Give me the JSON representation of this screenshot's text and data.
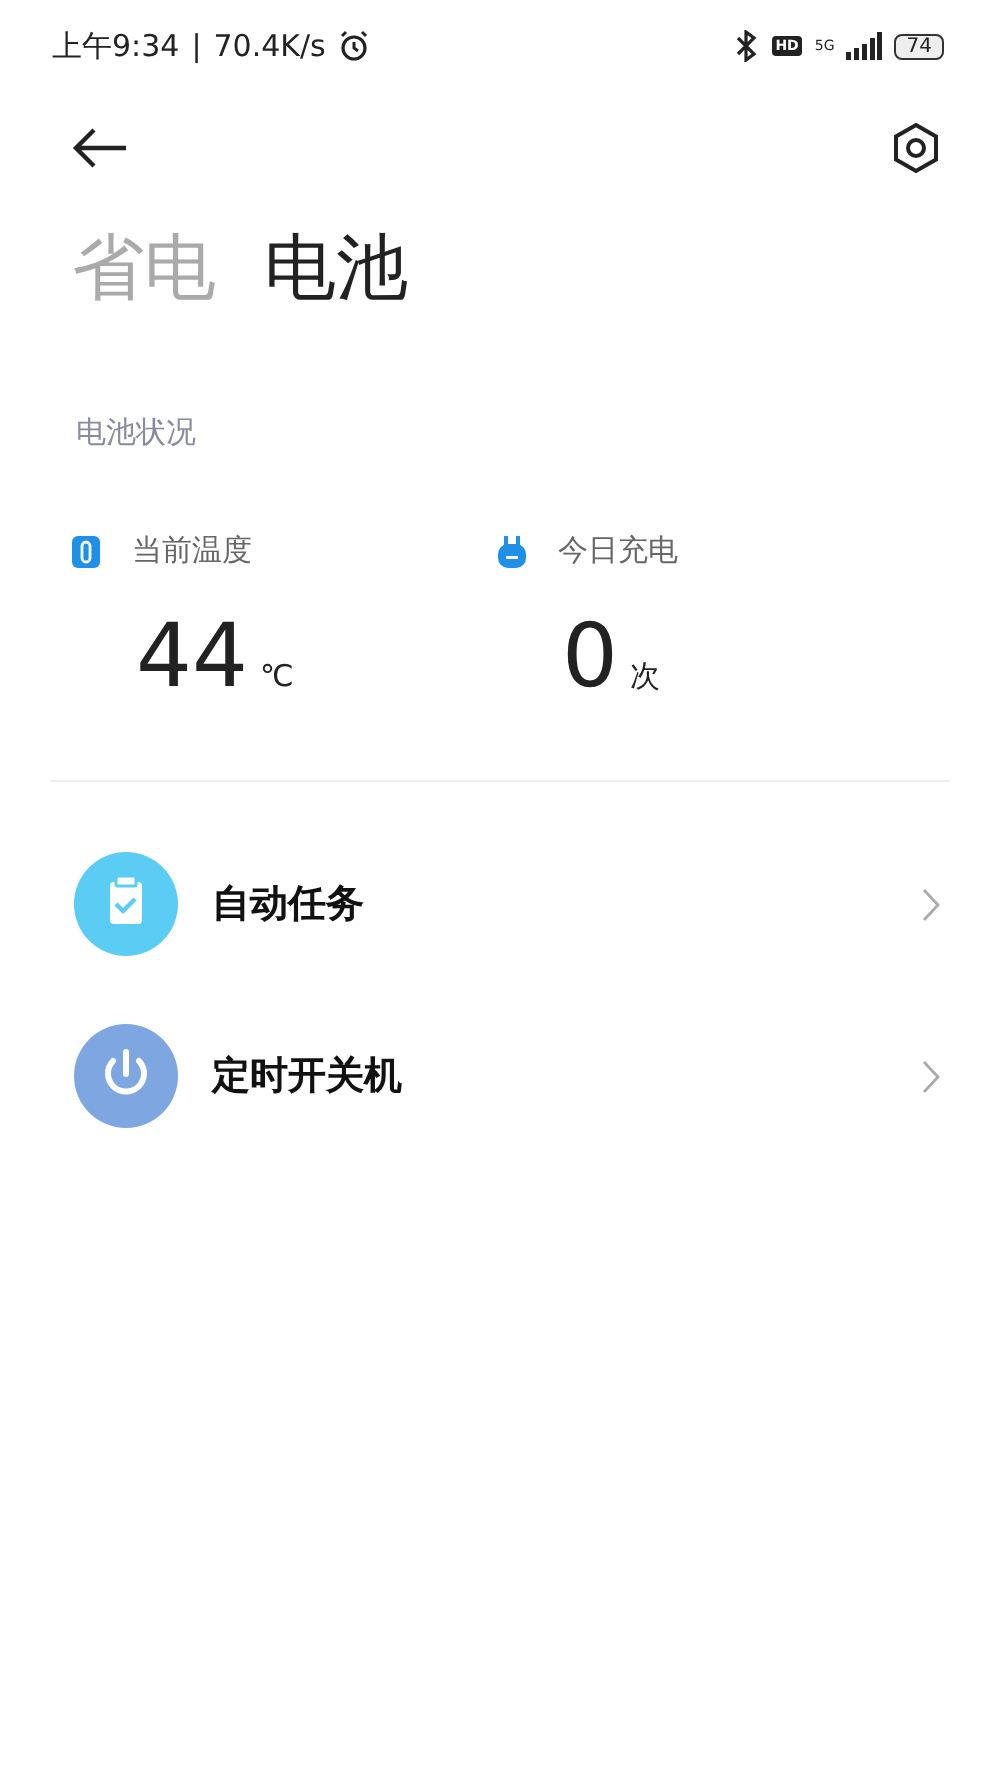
{
  "status_bar": {
    "time": "上午9:34",
    "separator": "|",
    "speed": "70.4K/s",
    "hd": "HD",
    "network": "5G",
    "battery": "74"
  },
  "tabs": [
    {
      "label": "省电",
      "selected": false
    },
    {
      "label": "电池",
      "selected": true
    }
  ],
  "section_title": "电池状况",
  "stats": [
    {
      "kind": "temperature",
      "label": "当前温度",
      "value": "44",
      "unit": "℃"
    },
    {
      "kind": "charge",
      "label": "今日充电",
      "value": "0",
      "unit": "次"
    }
  ],
  "menu": [
    {
      "kind": "task",
      "label": "自动任务",
      "color": "#5bcdf5"
    },
    {
      "kind": "power",
      "label": "定时开关机",
      "color": "#7ea6e0"
    }
  ]
}
